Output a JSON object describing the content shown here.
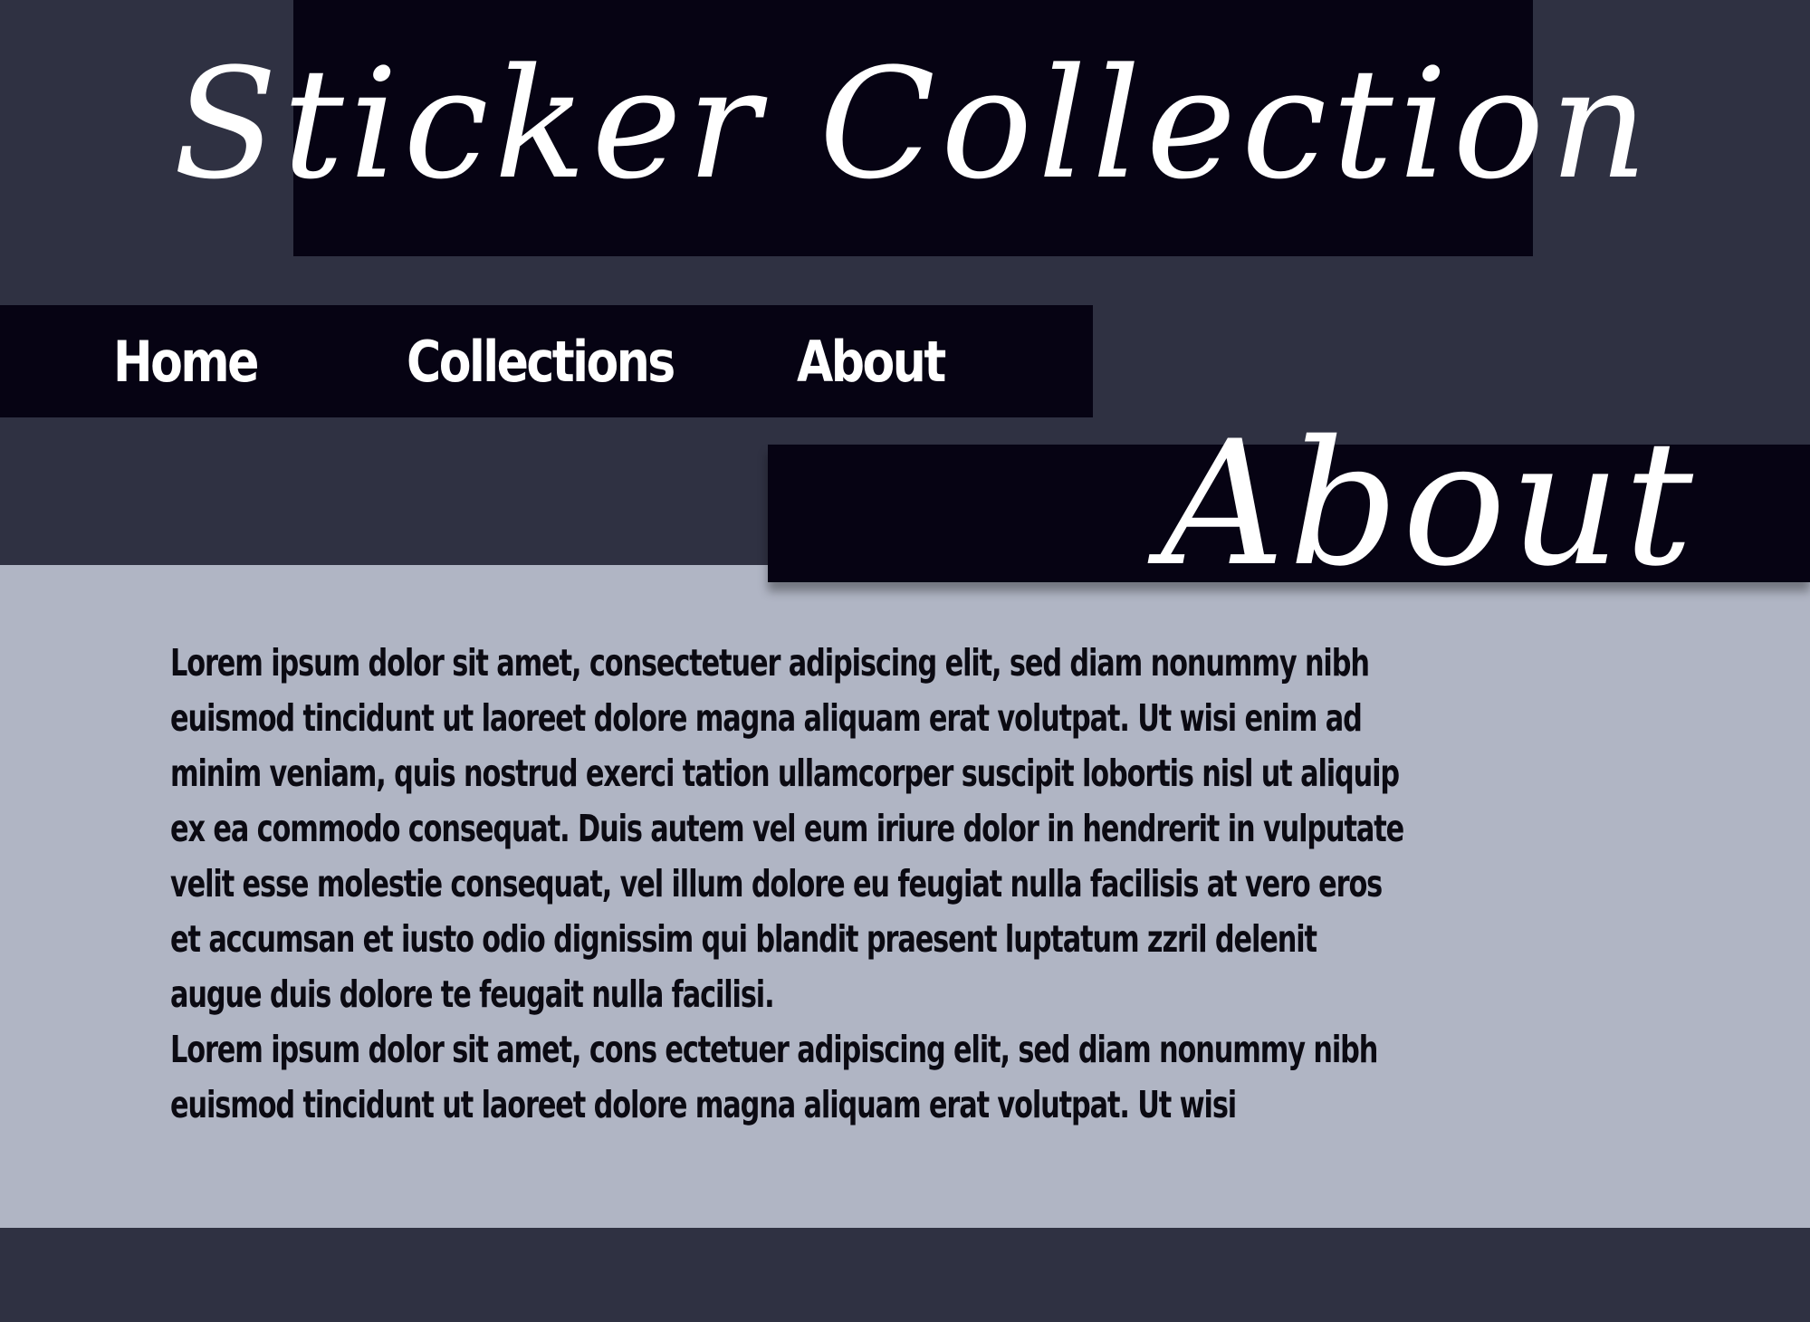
{
  "header": {
    "title": "Sticker Collection"
  },
  "nav": {
    "items": [
      {
        "label": "Home"
      },
      {
        "label": "Collections"
      },
      {
        "label": "About"
      }
    ]
  },
  "section": {
    "title": "About",
    "paragraphs": [
      "Lorem ipsum dolor sit amet, consectetuer adipiscing elit, sed diam nonummy nibh euismod tincidunt ut laoreet dolore magna aliquam erat volutpat. Ut wisi enim ad minim veniam, quis nostrud exerci tation ullamcorper suscipit lobortis nisl ut aliquip ex ea commodo consequat. Duis autem vel eum iriure dolor in hendrerit in vulputate velit esse molestie consequat, vel illum dolore eu feugiat nulla facilisis at vero eros et accumsan et iusto odio dignissim qui blandit praesent luptatum zzril delenit augue duis dolore te feugait nulla facilisi.",
      "Lorem ipsum dolor sit amet, cons ectetuer adipiscing elit, sed diam nonummy nibh euismod tincidunt ut laoreet dolore magna aliquam erat volutpat. Ut wisi"
    ]
  },
  "colors": {
    "page_background": "#2f3142",
    "panel_dark": "#060313",
    "content_background": "#b0b5c4",
    "heading_text": "#ffffff",
    "body_text": "#0b0a12"
  }
}
